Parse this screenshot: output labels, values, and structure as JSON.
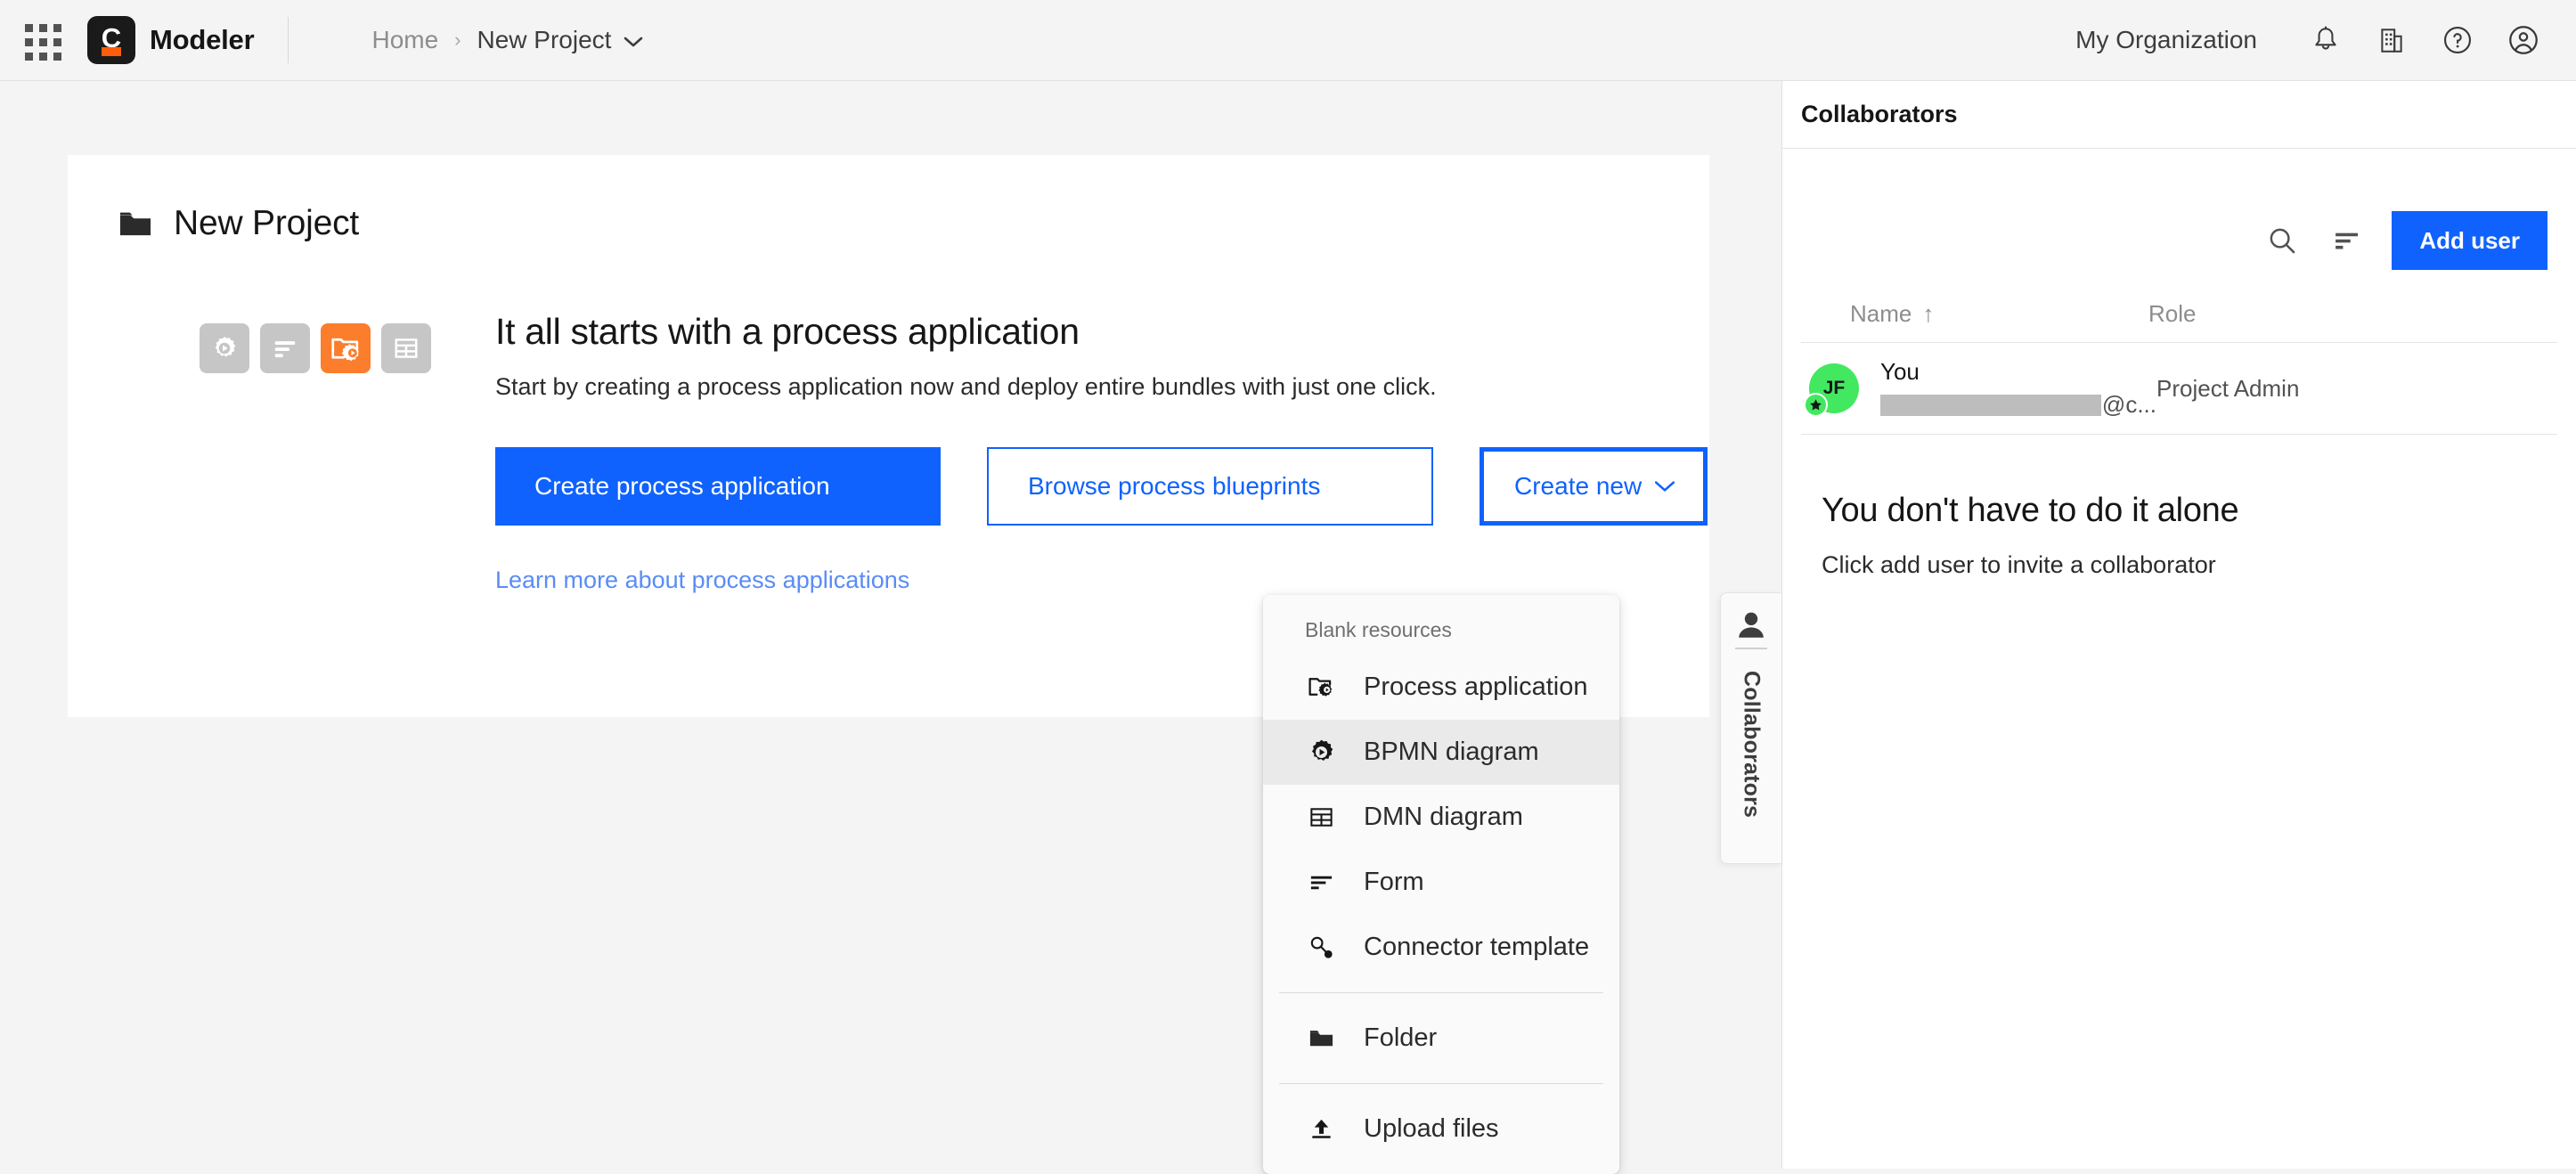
{
  "topnav": {
    "app_switcher_icon": "grid-icon",
    "logo_letter": "C",
    "product_name": "Modeler",
    "breadcrumb": {
      "home": "Home",
      "separator": "›",
      "current": "New Project"
    },
    "organization": "My Organization",
    "icons": [
      "notification-bell-icon",
      "organization-building-icon",
      "help-icon",
      "user-account-icon"
    ]
  },
  "project_card": {
    "folder_icon": "folder-icon",
    "title": "New Project",
    "resource_type_icons": [
      {
        "name": "bpmn-diagram-icon",
        "active": false
      },
      {
        "name": "form-icon",
        "active": false
      },
      {
        "name": "process-application-icon",
        "active": true
      },
      {
        "name": "dmn-diagram-icon",
        "active": false
      }
    ],
    "empty_state": {
      "heading": "It all starts with a process application",
      "subtext": "Start by creating a process application now and deploy entire bundles with just one click.",
      "primary_button": "Create process application",
      "secondary_button": "Browse process blueprints",
      "dropdown_button": "Create new",
      "learn_more_link": "Learn more about process applications"
    }
  },
  "create_menu": {
    "section_label": "Blank resources",
    "items": [
      {
        "label": "Process application",
        "icon": "process-application-icon",
        "hovered": false
      },
      {
        "label": "BPMN diagram",
        "icon": "bpmn-diagram-icon",
        "hovered": true
      },
      {
        "label": "DMN diagram",
        "icon": "dmn-diagram-icon",
        "hovered": false
      },
      {
        "label": "Form",
        "icon": "form-icon",
        "hovered": false
      },
      {
        "label": "Connector template",
        "icon": "connector-template-icon",
        "hovered": false
      }
    ],
    "folder_item": {
      "label": "Folder",
      "icon": "folder-icon"
    },
    "upload_item": {
      "label": "Upload files",
      "icon": "upload-icon"
    }
  },
  "side_tab": {
    "label": "Collaborators",
    "icon": "user-icon"
  },
  "collaborators_panel": {
    "title": "Collaborators",
    "search_icon": "search-icon",
    "sort_icon": "sort-icon",
    "add_user_button": "Add user",
    "columns": {
      "name": "Name",
      "role": "Role",
      "sort_arrow": "↑"
    },
    "rows": [
      {
        "avatar_initials": "JF",
        "avatar_color": "#42e860",
        "name": "You",
        "email_suffix": "@c...",
        "role": "Project Admin"
      }
    ],
    "empty_promo": {
      "heading": "You don't have to do it alone",
      "subtext": "Click add user to invite a collaborator"
    }
  },
  "colors": {
    "accent_blue": "#0f62fe",
    "accent_orange": "#fc7d2b",
    "brand_orange": "#fc5d0d",
    "page_background": "#f4f4f4",
    "card_background": "#ffffff",
    "link_blue": "#5a8cf5"
  }
}
